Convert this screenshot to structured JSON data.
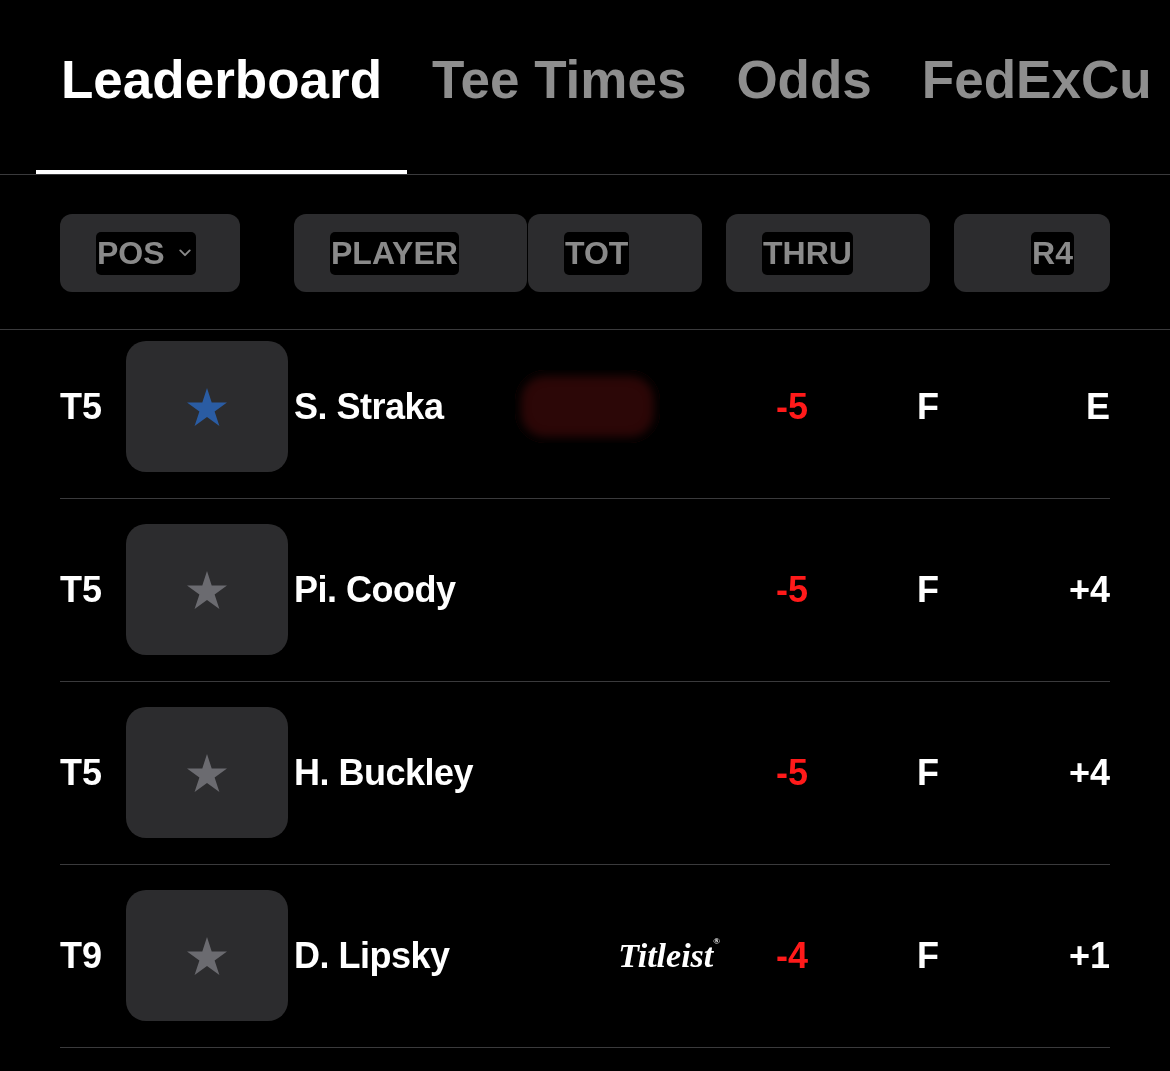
{
  "tabs": [
    {
      "label": "Leaderboard",
      "selected": true
    },
    {
      "label": "Tee Times",
      "selected": false
    },
    {
      "label": "Odds",
      "selected": false
    },
    {
      "label": "FedExCu",
      "selected": false
    }
  ],
  "columns": [
    {
      "label": "POS",
      "dropdown": true
    },
    {
      "label": "PLAYER",
      "dropdown": false
    },
    {
      "label": "TOT",
      "dropdown": false
    },
    {
      "label": "THRU",
      "dropdown": false
    },
    {
      "label": "R4",
      "dropdown": false
    }
  ],
  "rows": [
    {
      "pos": "T5",
      "favorite": true,
      "player": "S. Straka",
      "sponsor": {
        "kind": "blurred"
      },
      "tot": "-5",
      "thru": "F",
      "r4": "E"
    },
    {
      "pos": "T5",
      "favorite": false,
      "player": "Pi. Coody",
      "tot": "-5",
      "thru": "F",
      "r4": "+4"
    },
    {
      "pos": "T5",
      "favorite": false,
      "player": "H. Buckley",
      "tot": "-5",
      "thru": "F",
      "r4": "+4"
    },
    {
      "pos": "T9",
      "favorite": false,
      "player": "D. Lipsky",
      "sponsor": {
        "kind": "logo",
        "text": "Titleist$^{®}$"
      },
      "tot": "-4",
      "thru": "F",
      "r4": "+1"
    }
  ]
}
